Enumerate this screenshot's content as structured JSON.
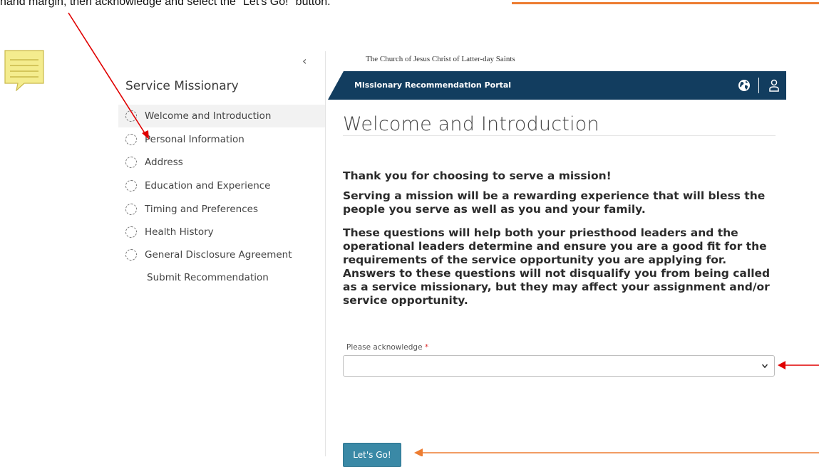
{
  "instruction": {
    "text": "hand margin, then acknowledge and select the \"Let's Go!\" button."
  },
  "sidebar": {
    "collapse_glyph": "‹",
    "title": "Service Missionary",
    "items": [
      {
        "label": "Welcome and Introduction",
        "icon": "progress-circle-icon",
        "active": true
      },
      {
        "label": "Personal Information",
        "icon": "progress-circle-icon"
      },
      {
        "label": "Address",
        "icon": "progress-circle-icon"
      },
      {
        "label": "Education and Experience",
        "icon": "progress-circle-icon"
      },
      {
        "label": "Timing and Preferences",
        "icon": "progress-circle-icon"
      },
      {
        "label": "Health History",
        "icon": "progress-circle-icon"
      },
      {
        "label": "General Disclosure Agreement",
        "icon": "progress-circle-icon"
      },
      {
        "label": "Submit Recommendation"
      }
    ]
  },
  "header": {
    "church_name": "The Church of Jesus Christ of Latter-day Saints",
    "portal_title": "Missionary Recommendation Portal",
    "icons": [
      "globe-icon",
      "user-icon"
    ]
  },
  "main": {
    "page_title": "Welcome and Introduction",
    "paragraphs": [
      "Thank you for choosing to serve a mission!",
      "Serving a mission will be a rewarding experience that will bless the people you serve as well as you and your family.",
      "These questions will help both your priesthood leaders and the operational leaders determine and ensure you are a good fit for the requirements of the service opportunity you are applying for. Answers to these questions will not disqualify you from being called as a service missionary, but they may affect your assignment and/or service opportunity."
    ],
    "acknowledge_label": "Please acknowledge",
    "required_mark": "*",
    "acknowledge_value": "",
    "submit_label": "Let's Go!"
  },
  "colors": {
    "portal_bar": "#123d5f",
    "button": "#3a89a6",
    "annotation_red": "#e00000",
    "annotation_orange": "#ed7d31",
    "note_icon": "#f4ec8e"
  }
}
